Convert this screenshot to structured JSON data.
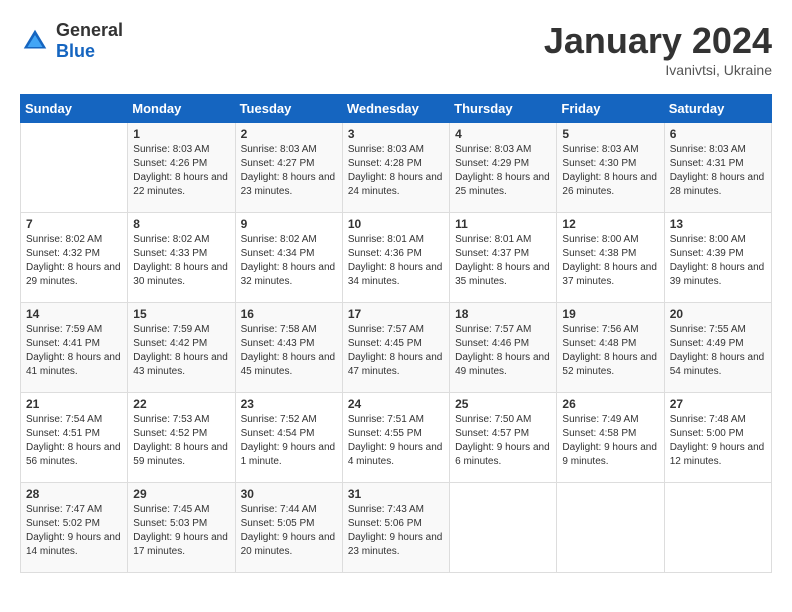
{
  "header": {
    "logo_general": "General",
    "logo_blue": "Blue",
    "title": "January 2024",
    "subtitle": "Ivanivtsi, Ukraine"
  },
  "weekdays": [
    "Sunday",
    "Monday",
    "Tuesday",
    "Wednesday",
    "Thursday",
    "Friday",
    "Saturday"
  ],
  "weeks": [
    [
      {
        "day": "",
        "sunrise": "",
        "sunset": "",
        "daylight": ""
      },
      {
        "day": "1",
        "sunrise": "Sunrise: 8:03 AM",
        "sunset": "Sunset: 4:26 PM",
        "daylight": "Daylight: 8 hours and 22 minutes."
      },
      {
        "day": "2",
        "sunrise": "Sunrise: 8:03 AM",
        "sunset": "Sunset: 4:27 PM",
        "daylight": "Daylight: 8 hours and 23 minutes."
      },
      {
        "day": "3",
        "sunrise": "Sunrise: 8:03 AM",
        "sunset": "Sunset: 4:28 PM",
        "daylight": "Daylight: 8 hours and 24 minutes."
      },
      {
        "day": "4",
        "sunrise": "Sunrise: 8:03 AM",
        "sunset": "Sunset: 4:29 PM",
        "daylight": "Daylight: 8 hours and 25 minutes."
      },
      {
        "day": "5",
        "sunrise": "Sunrise: 8:03 AM",
        "sunset": "Sunset: 4:30 PM",
        "daylight": "Daylight: 8 hours and 26 minutes."
      },
      {
        "day": "6",
        "sunrise": "Sunrise: 8:03 AM",
        "sunset": "Sunset: 4:31 PM",
        "daylight": "Daylight: 8 hours and 28 minutes."
      }
    ],
    [
      {
        "day": "7",
        "sunrise": "Sunrise: 8:02 AM",
        "sunset": "Sunset: 4:32 PM",
        "daylight": "Daylight: 8 hours and 29 minutes."
      },
      {
        "day": "8",
        "sunrise": "Sunrise: 8:02 AM",
        "sunset": "Sunset: 4:33 PM",
        "daylight": "Daylight: 8 hours and 30 minutes."
      },
      {
        "day": "9",
        "sunrise": "Sunrise: 8:02 AM",
        "sunset": "Sunset: 4:34 PM",
        "daylight": "Daylight: 8 hours and 32 minutes."
      },
      {
        "day": "10",
        "sunrise": "Sunrise: 8:01 AM",
        "sunset": "Sunset: 4:36 PM",
        "daylight": "Daylight: 8 hours and 34 minutes."
      },
      {
        "day": "11",
        "sunrise": "Sunrise: 8:01 AM",
        "sunset": "Sunset: 4:37 PM",
        "daylight": "Daylight: 8 hours and 35 minutes."
      },
      {
        "day": "12",
        "sunrise": "Sunrise: 8:00 AM",
        "sunset": "Sunset: 4:38 PM",
        "daylight": "Daylight: 8 hours and 37 minutes."
      },
      {
        "day": "13",
        "sunrise": "Sunrise: 8:00 AM",
        "sunset": "Sunset: 4:39 PM",
        "daylight": "Daylight: 8 hours and 39 minutes."
      }
    ],
    [
      {
        "day": "14",
        "sunrise": "Sunrise: 7:59 AM",
        "sunset": "Sunset: 4:41 PM",
        "daylight": "Daylight: 8 hours and 41 minutes."
      },
      {
        "day": "15",
        "sunrise": "Sunrise: 7:59 AM",
        "sunset": "Sunset: 4:42 PM",
        "daylight": "Daylight: 8 hours and 43 minutes."
      },
      {
        "day": "16",
        "sunrise": "Sunrise: 7:58 AM",
        "sunset": "Sunset: 4:43 PM",
        "daylight": "Daylight: 8 hours and 45 minutes."
      },
      {
        "day": "17",
        "sunrise": "Sunrise: 7:57 AM",
        "sunset": "Sunset: 4:45 PM",
        "daylight": "Daylight: 8 hours and 47 minutes."
      },
      {
        "day": "18",
        "sunrise": "Sunrise: 7:57 AM",
        "sunset": "Sunset: 4:46 PM",
        "daylight": "Daylight: 8 hours and 49 minutes."
      },
      {
        "day": "19",
        "sunrise": "Sunrise: 7:56 AM",
        "sunset": "Sunset: 4:48 PM",
        "daylight": "Daylight: 8 hours and 52 minutes."
      },
      {
        "day": "20",
        "sunrise": "Sunrise: 7:55 AM",
        "sunset": "Sunset: 4:49 PM",
        "daylight": "Daylight: 8 hours and 54 minutes."
      }
    ],
    [
      {
        "day": "21",
        "sunrise": "Sunrise: 7:54 AM",
        "sunset": "Sunset: 4:51 PM",
        "daylight": "Daylight: 8 hours and 56 minutes."
      },
      {
        "day": "22",
        "sunrise": "Sunrise: 7:53 AM",
        "sunset": "Sunset: 4:52 PM",
        "daylight": "Daylight: 8 hours and 59 minutes."
      },
      {
        "day": "23",
        "sunrise": "Sunrise: 7:52 AM",
        "sunset": "Sunset: 4:54 PM",
        "daylight": "Daylight: 9 hours and 1 minute."
      },
      {
        "day": "24",
        "sunrise": "Sunrise: 7:51 AM",
        "sunset": "Sunset: 4:55 PM",
        "daylight": "Daylight: 9 hours and 4 minutes."
      },
      {
        "day": "25",
        "sunrise": "Sunrise: 7:50 AM",
        "sunset": "Sunset: 4:57 PM",
        "daylight": "Daylight: 9 hours and 6 minutes."
      },
      {
        "day": "26",
        "sunrise": "Sunrise: 7:49 AM",
        "sunset": "Sunset: 4:58 PM",
        "daylight": "Daylight: 9 hours and 9 minutes."
      },
      {
        "day": "27",
        "sunrise": "Sunrise: 7:48 AM",
        "sunset": "Sunset: 5:00 PM",
        "daylight": "Daylight: 9 hours and 12 minutes."
      }
    ],
    [
      {
        "day": "28",
        "sunrise": "Sunrise: 7:47 AM",
        "sunset": "Sunset: 5:02 PM",
        "daylight": "Daylight: 9 hours and 14 minutes."
      },
      {
        "day": "29",
        "sunrise": "Sunrise: 7:45 AM",
        "sunset": "Sunset: 5:03 PM",
        "daylight": "Daylight: 9 hours and 17 minutes."
      },
      {
        "day": "30",
        "sunrise": "Sunrise: 7:44 AM",
        "sunset": "Sunset: 5:05 PM",
        "daylight": "Daylight: 9 hours and 20 minutes."
      },
      {
        "day": "31",
        "sunrise": "Sunrise: 7:43 AM",
        "sunset": "Sunset: 5:06 PM",
        "daylight": "Daylight: 9 hours and 23 minutes."
      },
      {
        "day": "",
        "sunrise": "",
        "sunset": "",
        "daylight": ""
      },
      {
        "day": "",
        "sunrise": "",
        "sunset": "",
        "daylight": ""
      },
      {
        "day": "",
        "sunrise": "",
        "sunset": "",
        "daylight": ""
      }
    ]
  ]
}
